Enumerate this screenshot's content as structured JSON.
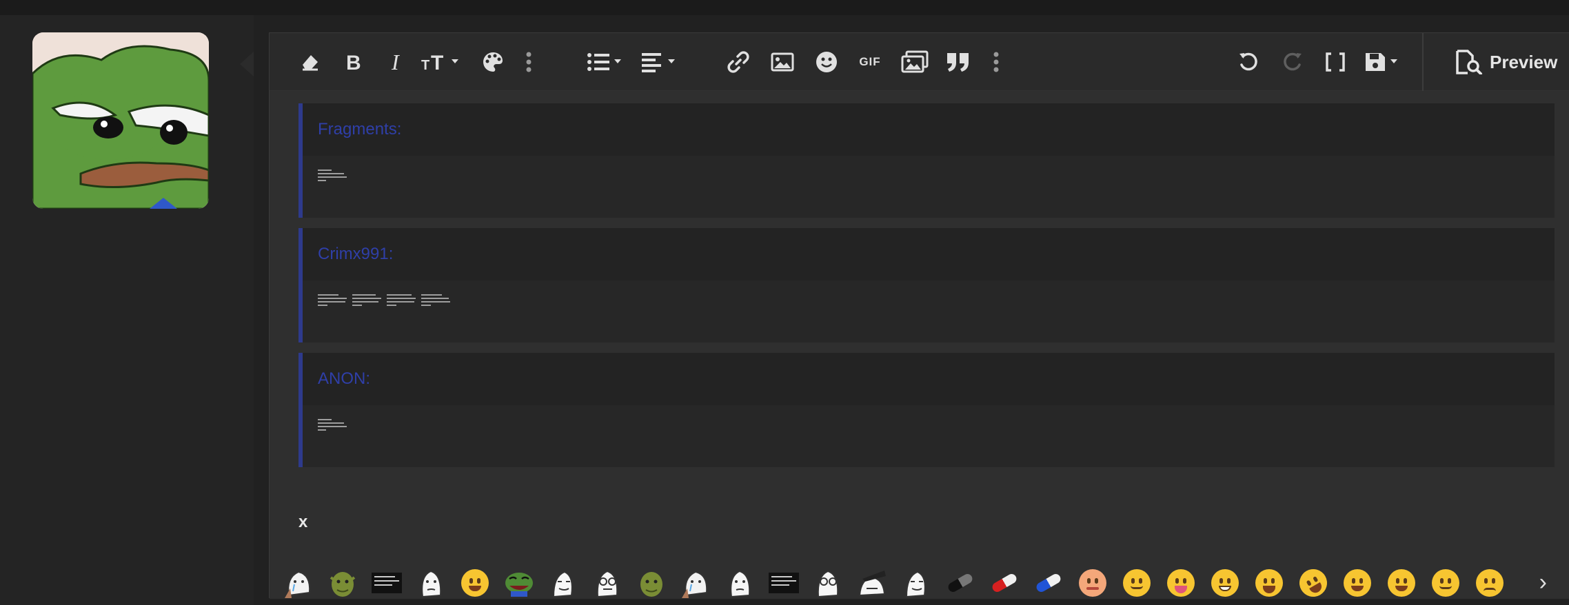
{
  "toolbar": {
    "preview_label": "Preview",
    "gif_label": "GIF"
  },
  "quotes": [
    {
      "author": "Fragments:"
    },
    {
      "author": "Crimx991:"
    },
    {
      "author": "ANON:"
    }
  ],
  "editor": {
    "typed_text": "x"
  },
  "colors": {
    "accent_quote": "#2e3a8c",
    "background": "#212121",
    "editor_bg": "#2f2f2f"
  },
  "smilies": [
    "wojak-crying-icon",
    "shrek-icon",
    "text-meme-icon",
    "wojak-icon",
    "joy-emoji-icon",
    "pepe-laugh-icon",
    "wojak-smug-icon",
    "wojak-glasses-icon",
    "shrek-icon",
    "wojak-crying-icon",
    "wojak-icon",
    "text-meme-icon",
    "wojak-glasses-icon",
    "wojak-hat-icon",
    "wojak-smug-icon",
    "black-pill-icon",
    "red-pill-icon",
    "blue-pill-icon",
    "zipper-mouth-emoji-icon",
    "slight-smile-emoji-icon",
    "tongue-emoji-icon",
    "grin-emoji-icon",
    "laughing-emoji-icon",
    "rofl-emoji-icon",
    "joy-emoji-icon",
    "star-struck-emoji-icon",
    "wink-emoji-icon",
    "frown-emoji-icon"
  ]
}
